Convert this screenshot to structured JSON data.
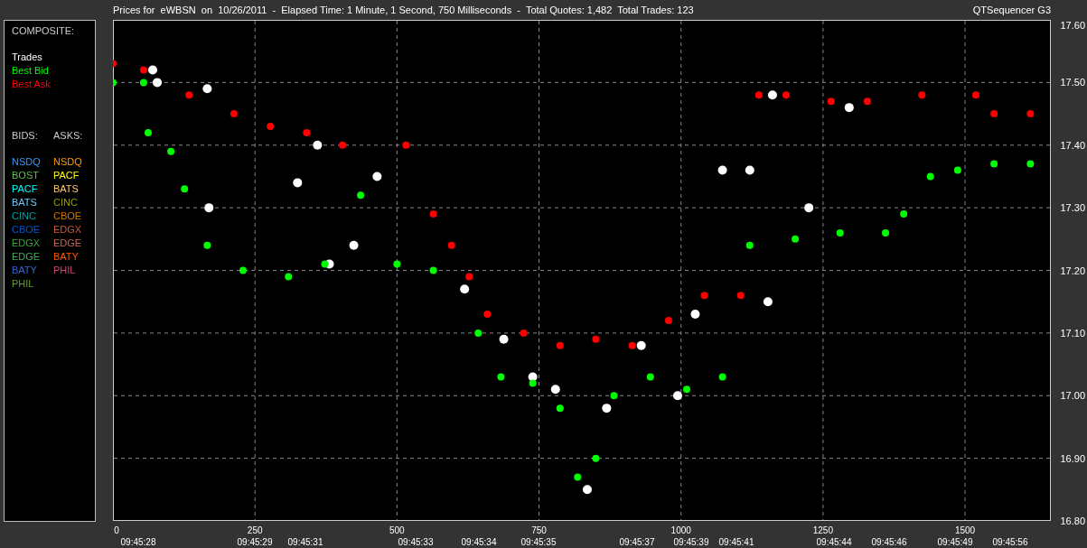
{
  "title": "Prices for  eWBSN  on  10/26/2011  -  Elapsed Time: 1 Minute, 1 Second, 750 Milliseconds  -  Total Quotes: 1,482  Total Trades: 123",
  "app_name": "QTSequencer G3",
  "legend": {
    "composite_heading": "COMPOSITE:",
    "bids_heading": "BIDS:",
    "asks_heading": "ASKS:",
    "bids": [
      {
        "label": "NSDQ",
        "color": "#3399ff"
      },
      {
        "label": "BOST",
        "color": "#66bb55"
      },
      {
        "label": "PACF",
        "color": "#00ffff"
      },
      {
        "label": "BATS",
        "color": "#66ccff"
      },
      {
        "label": "CINC",
        "color": "#00a0a0"
      },
      {
        "label": "CBOE",
        "color": "#0055cc"
      },
      {
        "label": "EDGX",
        "color": "#33aa33"
      },
      {
        "label": "EDGE",
        "color": "#44aa55"
      },
      {
        "label": "BATY",
        "color": "#3366cc"
      },
      {
        "label": "PHIL",
        "color": "#669933"
      }
    ],
    "asks": [
      {
        "label": "NSDQ",
        "color": "#ff9900"
      },
      {
        "label": "PACF",
        "color": "#ffff00"
      },
      {
        "label": "BATS",
        "color": "#ffcc66"
      },
      {
        "label": "CINC",
        "color": "#999900"
      },
      {
        "label": "CBOE",
        "color": "#cc7700"
      },
      {
        "label": "EDGX",
        "color": "#cc5533"
      },
      {
        "label": "EDGE",
        "color": "#cc6655"
      },
      {
        "label": "BATY",
        "color": "#ff5500"
      },
      {
        "label": "PHIL",
        "color": "#cc4477"
      }
    ]
  },
  "time_axis": [
    "09:45:28",
    "09:45:29",
    "09:45:31",
    "09:45:33",
    "09:45:34",
    "09:45:35",
    "09:45:37",
    "09:45:39",
    "09:45:41",
    "09:45:44",
    "09:45:46",
    "09:45:49",
    "09:45:56"
  ],
  "chart_data": {
    "type": "scatter",
    "grid": true,
    "xlim": [
      0,
      1651
    ],
    "ylim": [
      16.8,
      17.6
    ],
    "xticks": [
      0,
      250,
      500,
      750,
      1000,
      1250,
      1500
    ],
    "yticks": [
      {
        "value": 16.8,
        "label": "16.80"
      },
      {
        "value": 16.9,
        "label": "16.90"
      },
      {
        "value": 17.0,
        "label": "17.00"
      },
      {
        "value": 17.1,
        "label": "17.10"
      },
      {
        "value": 17.2,
        "label": "17.20"
      },
      {
        "value": 17.3,
        "label": "17.30"
      },
      {
        "value": 17.4,
        "label": "17.40"
      },
      {
        "value": 17.5,
        "label": "17.50"
      },
      {
        "value": 17.6,
        "label": "17.60"
      }
    ],
    "series": [
      {
        "name": "Trades",
        "color": "#ffffff",
        "x": [
          70,
          78,
          166,
          169,
          325,
          360,
          381,
          424,
          465,
          619,
          688,
          739,
          779,
          835,
          869,
          930,
          994,
          1025,
          1073,
          1121,
          1153,
          1161,
          1225,
          1296
        ],
        "values": [
          17.52,
          17.5,
          17.49,
          17.3,
          17.34,
          17.4,
          17.21,
          17.24,
          17.35,
          17.17,
          17.09,
          17.03,
          17.01,
          16.85,
          16.98,
          17.08,
          17.0,
          17.13,
          17.36,
          17.36,
          17.15,
          17.48,
          17.3,
          17.46
        ]
      },
      {
        "name": "Best Bid",
        "color": "#00ff00",
        "x": [
          0,
          54,
          62,
          102,
          126,
          166,
          229,
          309,
          373,
          436,
          500,
          564,
          643,
          683,
          739,
          787,
          818,
          850,
          882,
          946,
          1010,
          1073,
          1121,
          1201,
          1280,
          1360,
          1392,
          1439,
          1487,
          1551,
          1615
        ],
        "values": [
          17.5,
          17.5,
          17.42,
          17.39,
          17.33,
          17.24,
          17.2,
          17.19,
          17.21,
          17.32,
          17.21,
          17.2,
          17.1,
          17.03,
          17.02,
          16.98,
          16.87,
          16.9,
          17.0,
          17.03,
          17.01,
          17.03,
          17.24,
          17.25,
          17.26,
          17.26,
          17.29,
          17.35,
          17.36,
          17.37,
          17.37
        ]
      },
      {
        "name": "Best Ask",
        "color": "#ff0000",
        "x": [
          0,
          54,
          134,
          213,
          277,
          341,
          404,
          516,
          564,
          596,
          627,
          659,
          723,
          787,
          850,
          914,
          978,
          1041,
          1105,
          1137,
          1185,
          1264,
          1328,
          1424,
          1519,
          1551,
          1615
        ],
        "values": [
          17.53,
          17.52,
          17.48,
          17.45,
          17.43,
          17.42,
          17.4,
          17.4,
          17.29,
          17.24,
          17.19,
          17.13,
          17.1,
          17.08,
          17.09,
          17.08,
          17.12,
          17.16,
          17.16,
          17.48,
          17.48,
          17.47,
          17.47,
          17.48,
          17.48,
          17.45,
          17.45
        ]
      }
    ]
  }
}
